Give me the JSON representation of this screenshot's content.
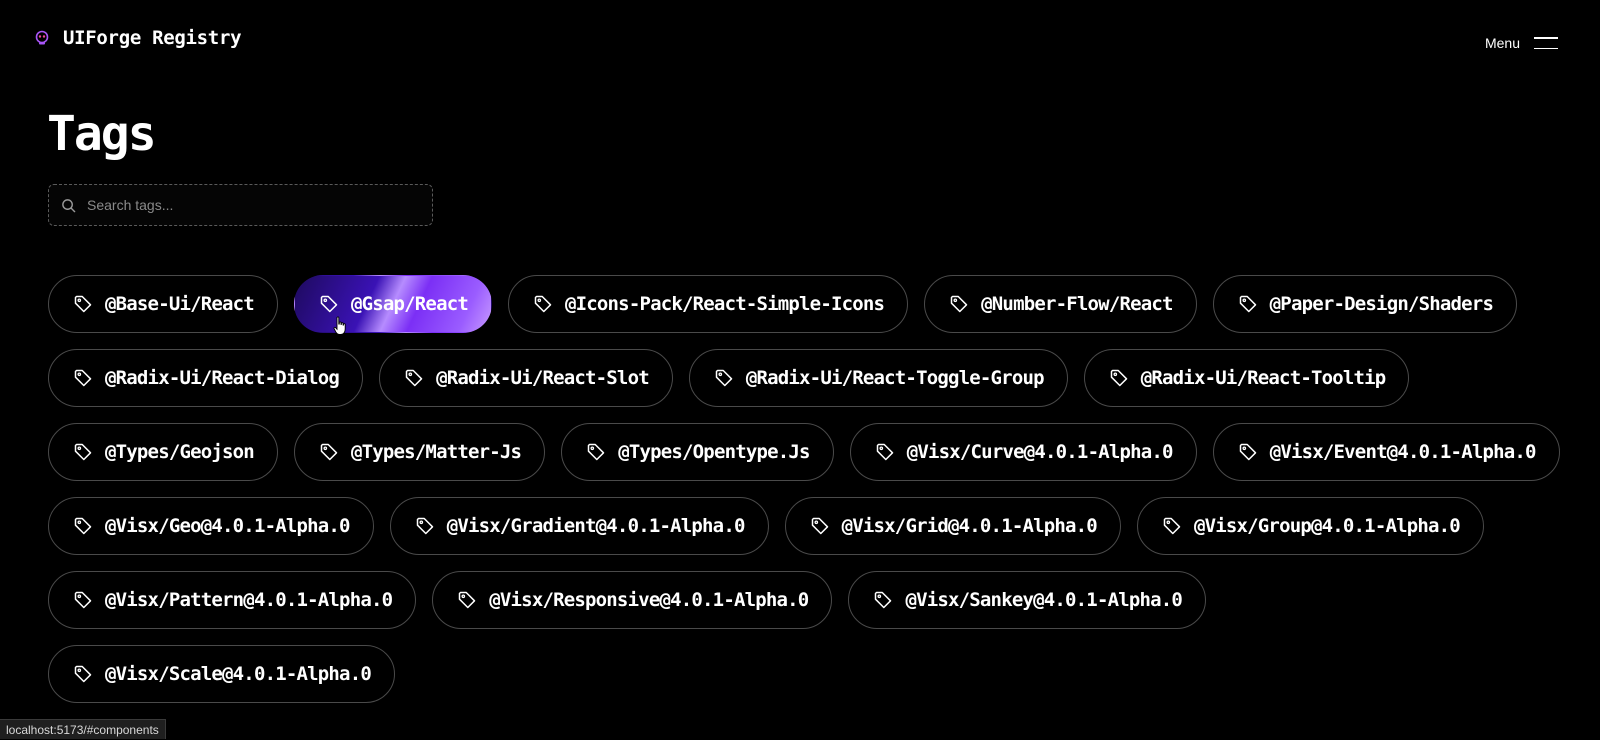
{
  "header": {
    "brand": "UIForge Registry",
    "menu_label": "Menu"
  },
  "page": {
    "title": "Tags"
  },
  "search": {
    "placeholder": "Search tags..."
  },
  "tags": [
    {
      "label": "@Base-Ui/React",
      "active": false
    },
    {
      "label": "@Gsap/React",
      "active": true
    },
    {
      "label": "@Icons-Pack/React-Simple-Icons",
      "active": false
    },
    {
      "label": "@Number-Flow/React",
      "active": false
    },
    {
      "label": "@Paper-Design/Shaders",
      "active": false
    },
    {
      "label": "@Radix-Ui/React-Dialog",
      "active": false
    },
    {
      "label": "@Radix-Ui/React-Slot",
      "active": false
    },
    {
      "label": "@Radix-Ui/React-Toggle-Group",
      "active": false
    },
    {
      "label": "@Radix-Ui/React-Tooltip",
      "active": false
    },
    {
      "label": "@Types/Geojson",
      "active": false
    },
    {
      "label": "@Types/Matter-Js",
      "active": false
    },
    {
      "label": "@Types/Opentype.Js",
      "active": false
    },
    {
      "label": "@Visx/Curve@4.0.1-Alpha.0",
      "active": false
    },
    {
      "label": "@Visx/Event@4.0.1-Alpha.0",
      "active": false
    },
    {
      "label": "@Visx/Geo@4.0.1-Alpha.0",
      "active": false
    },
    {
      "label": "@Visx/Gradient@4.0.1-Alpha.0",
      "active": false
    },
    {
      "label": "@Visx/Grid@4.0.1-Alpha.0",
      "active": false
    },
    {
      "label": "@Visx/Group@4.0.1-Alpha.0",
      "active": false
    },
    {
      "label": "@Visx/Pattern@4.0.1-Alpha.0",
      "active": false
    },
    {
      "label": "@Visx/Responsive@4.0.1-Alpha.0",
      "active": false
    },
    {
      "label": "@Visx/Sankey@4.0.1-Alpha.0",
      "active": false
    },
    {
      "label": "@Visx/Scale@4.0.1-Alpha.0",
      "active": false
    }
  ],
  "status_bar": {
    "url": "localhost:5173/#components"
  },
  "colors": {
    "background": "#000000",
    "text": "#ffffff",
    "tag_border": "#4a4a4a",
    "active_gradient_start": "#1e0a5e",
    "active_gradient_end": "#c89bff"
  }
}
